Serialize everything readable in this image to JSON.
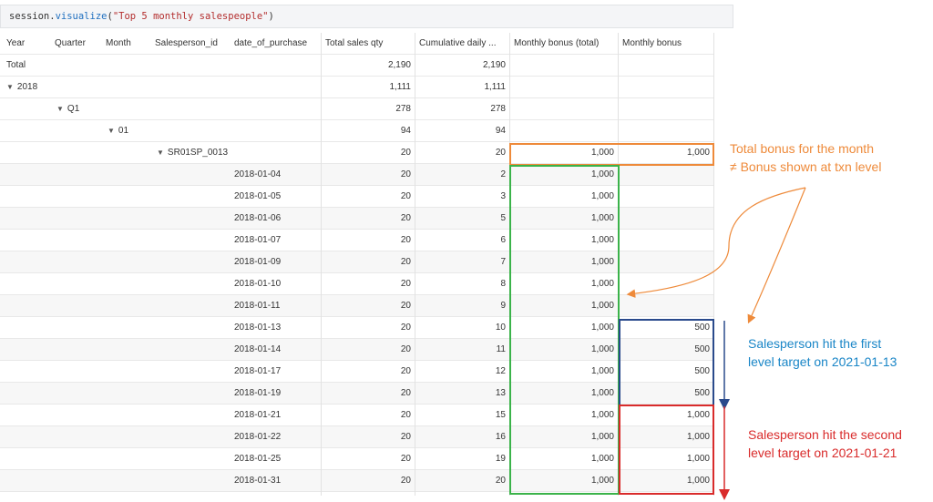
{
  "code": {
    "prefix": "session.",
    "function": "visualize",
    "open": "(",
    "argument": "\"Top 5 monthly salespeople\"",
    "close": ")"
  },
  "columns": [
    "Year",
    "Quarter",
    "Month",
    "Salesperson_id",
    "date_of_purchase",
    "Total sales qty",
    "Cumulative daily ...",
    "Monthly bonus (total)",
    "Monthly bonus"
  ],
  "rows": [
    {
      "label": "Total",
      "indent": "year",
      "caret": false,
      "date": "",
      "qty": "2,190",
      "cum": "2,190",
      "bonus_total": "",
      "bonus": ""
    },
    {
      "label": "2018",
      "indent": "year",
      "caret": true,
      "date": "",
      "qty": "1,111",
      "cum": "1,111",
      "bonus_total": "",
      "bonus": ""
    },
    {
      "label": "Q1",
      "indent": "quarter",
      "caret": true,
      "date": "",
      "qty": "278",
      "cum": "278",
      "bonus_total": "",
      "bonus": ""
    },
    {
      "label": "01",
      "indent": "month",
      "caret": true,
      "date": "",
      "qty": "94",
      "cum": "94",
      "bonus_total": "",
      "bonus": ""
    },
    {
      "label": "SR01SP_0013",
      "indent": "salesperson",
      "caret": true,
      "date": "",
      "qty": "20",
      "cum": "20",
      "bonus_total": "1,000",
      "bonus": "1,000"
    },
    {
      "label": "",
      "indent": "",
      "caret": false,
      "date": "2018-01-04",
      "qty": "20",
      "cum": "2",
      "bonus_total": "1,000",
      "bonus": ""
    },
    {
      "label": "",
      "indent": "",
      "caret": false,
      "date": "2018-01-05",
      "qty": "20",
      "cum": "3",
      "bonus_total": "1,000",
      "bonus": ""
    },
    {
      "label": "",
      "indent": "",
      "caret": false,
      "date": "2018-01-06",
      "qty": "20",
      "cum": "5",
      "bonus_total": "1,000",
      "bonus": ""
    },
    {
      "label": "",
      "indent": "",
      "caret": false,
      "date": "2018-01-07",
      "qty": "20",
      "cum": "6",
      "bonus_total": "1,000",
      "bonus": ""
    },
    {
      "label": "",
      "indent": "",
      "caret": false,
      "date": "2018-01-09",
      "qty": "20",
      "cum": "7",
      "bonus_total": "1,000",
      "bonus": ""
    },
    {
      "label": "",
      "indent": "",
      "caret": false,
      "date": "2018-01-10",
      "qty": "20",
      "cum": "8",
      "bonus_total": "1,000",
      "bonus": ""
    },
    {
      "label": "",
      "indent": "",
      "caret": false,
      "date": "2018-01-11",
      "qty": "20",
      "cum": "9",
      "bonus_total": "1,000",
      "bonus": ""
    },
    {
      "label": "",
      "indent": "",
      "caret": false,
      "date": "2018-01-13",
      "qty": "20",
      "cum": "10",
      "bonus_total": "1,000",
      "bonus": "500"
    },
    {
      "label": "",
      "indent": "",
      "caret": false,
      "date": "2018-01-14",
      "qty": "20",
      "cum": "11",
      "bonus_total": "1,000",
      "bonus": "500"
    },
    {
      "label": "",
      "indent": "",
      "caret": false,
      "date": "2018-01-17",
      "qty": "20",
      "cum": "12",
      "bonus_total": "1,000",
      "bonus": "500"
    },
    {
      "label": "",
      "indent": "",
      "caret": false,
      "date": "2018-01-19",
      "qty": "20",
      "cum": "13",
      "bonus_total": "1,000",
      "bonus": "500"
    },
    {
      "label": "",
      "indent": "",
      "caret": false,
      "date": "2018-01-21",
      "qty": "20",
      "cum": "15",
      "bonus_total": "1,000",
      "bonus": "1,000"
    },
    {
      "label": "",
      "indent": "",
      "caret": false,
      "date": "2018-01-22",
      "qty": "20",
      "cum": "16",
      "bonus_total": "1,000",
      "bonus": "1,000"
    },
    {
      "label": "",
      "indent": "",
      "caret": false,
      "date": "2018-01-25",
      "qty": "20",
      "cum": "19",
      "bonus_total": "1,000",
      "bonus": "1,000"
    },
    {
      "label": "",
      "indent": "",
      "caret": false,
      "date": "2018-01-31",
      "qty": "20",
      "cum": "20",
      "bonus_total": "1,000",
      "bonus": "1,000"
    }
  ],
  "annotations": {
    "orange": {
      "line1": "Total bonus for the month",
      "line2": "≠ Bonus shown at txn level",
      "color": "#ee8a3a"
    },
    "blue": {
      "line1": "Salesperson hit the first",
      "line2": "level target on 2021-01-13",
      "color": "#1a86c7"
    },
    "red": {
      "line1": "Salesperson hit the second",
      "line2": "level target on 2021-01-21",
      "color": "#d92b2b"
    },
    "green_color": "#3bb34a",
    "navy_color": "#2a4a8c"
  },
  "icons": {
    "expand": "caret-down-icon"
  }
}
